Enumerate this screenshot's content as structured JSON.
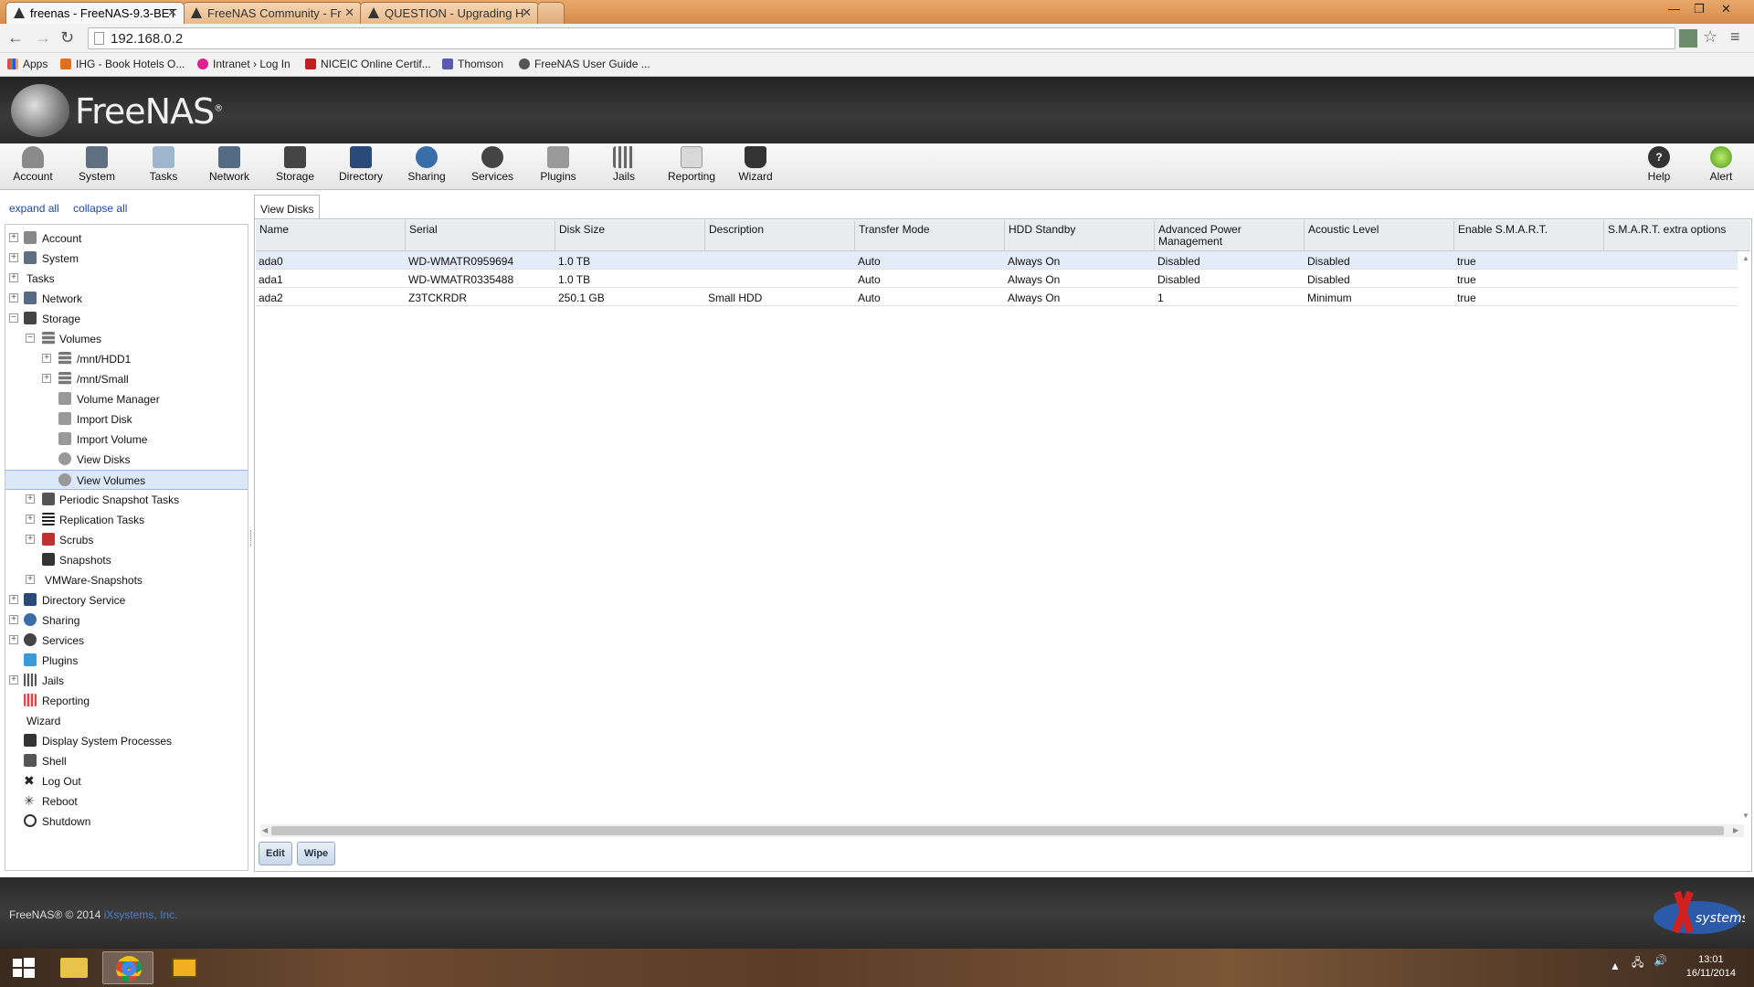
{
  "browser": {
    "tabs": [
      {
        "title": "freenas - FreeNAS-9.3-BET",
        "active": true
      },
      {
        "title": "FreeNAS Community - Fr",
        "active": false
      },
      {
        "title": "QUESTION - Upgrading H",
        "active": false
      }
    ],
    "url": "192.168.0.2",
    "bookmarks": [
      "Apps",
      "IHG - Book Hotels O...",
      "Intranet › Log In",
      "NICEIC Online Certif...",
      "Thomson",
      "FreeNAS User Guide ..."
    ]
  },
  "app": {
    "name": "FreeNAS",
    "toolbar": [
      "Account",
      "System",
      "Tasks",
      "Network",
      "Storage",
      "Directory",
      "Sharing",
      "Services",
      "Plugins",
      "Jails",
      "Reporting",
      "Wizard"
    ],
    "toolbar_right": [
      "Help",
      "Alert"
    ]
  },
  "tree": {
    "expand_all": "expand all",
    "collapse_all": "collapse all",
    "items": [
      {
        "label": "Account"
      },
      {
        "label": "System"
      },
      {
        "label": "Tasks"
      },
      {
        "label": "Network"
      },
      {
        "label": "Storage"
      },
      {
        "label": "Volumes"
      },
      {
        "label": "/mnt/HDD1"
      },
      {
        "label": "/mnt/Small"
      },
      {
        "label": "Volume Manager"
      },
      {
        "label": "Import Disk"
      },
      {
        "label": "Import Volume"
      },
      {
        "label": "View Disks"
      },
      {
        "label": "View Volumes"
      },
      {
        "label": "Periodic Snapshot Tasks"
      },
      {
        "label": "Replication Tasks"
      },
      {
        "label": "Scrubs"
      },
      {
        "label": "Snapshots"
      },
      {
        "label": "VMWare-Snapshots"
      },
      {
        "label": "Directory Service"
      },
      {
        "label": "Sharing"
      },
      {
        "label": "Services"
      },
      {
        "label": "Plugins"
      },
      {
        "label": "Jails"
      },
      {
        "label": "Reporting"
      },
      {
        "label": "Wizard"
      },
      {
        "label": "Display System Processes"
      },
      {
        "label": "Shell"
      },
      {
        "label": "Log Out"
      },
      {
        "label": "Reboot"
      },
      {
        "label": "Shutdown"
      }
    ]
  },
  "panel": {
    "tab_label": "View Disks",
    "columns": [
      "Name",
      "Serial",
      "Disk Size",
      "Description",
      "Transfer Mode",
      "HDD Standby",
      "Advanced Power Management",
      "Acoustic Level",
      "Enable S.M.A.R.T.",
      "S.M.A.R.T. extra options"
    ],
    "rows": [
      [
        "ada0",
        "WD-WMATR0959694",
        "1.0 TB",
        "",
        "Auto",
        "Always On",
        "Disabled",
        "Disabled",
        "true",
        ""
      ],
      [
        "ada1",
        "WD-WMATR0335488",
        "1.0 TB",
        "",
        "Auto",
        "Always On",
        "Disabled",
        "Disabled",
        "true",
        ""
      ],
      [
        "ada2",
        "Z3TCKRDR",
        "250.1 GB",
        "Small HDD",
        "Auto",
        "Always On",
        "1",
        "Minimum",
        "true",
        ""
      ]
    ],
    "buttons": {
      "edit": "Edit",
      "wipe": "Wipe"
    }
  },
  "footer": {
    "copyright": "FreeNAS® © 2014",
    "company": "iXsystems, Inc."
  },
  "taskbar": {
    "time": "13:01",
    "date": "16/11/2014"
  }
}
